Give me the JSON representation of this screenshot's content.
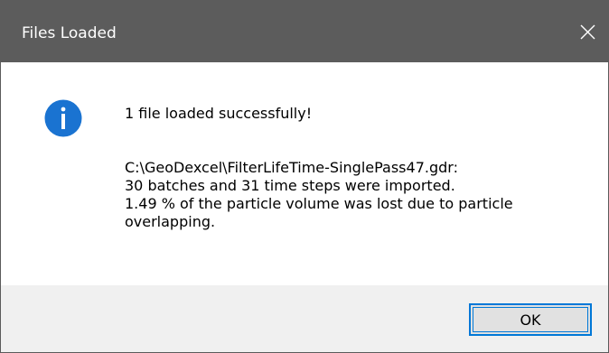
{
  "window": {
    "title": "Files Loaded",
    "close_icon": "close-icon"
  },
  "message": {
    "icon": "info-icon",
    "headline": "1 file loaded successfully!",
    "lines": [
      "C:\\GeoDexcel\\FilterLifeTime-SinglePass47.gdr:",
      "30 batches and 31 time steps were imported.",
      "1.49 % of the particle volume was lost due to particle",
      "overlapping."
    ]
  },
  "buttons": {
    "ok_label": "OK"
  },
  "colors": {
    "titlebar": "#5c5c5c",
    "info_icon": "#1a73d1",
    "footer": "#f0f0f0",
    "focus_border": "#0078d7"
  }
}
